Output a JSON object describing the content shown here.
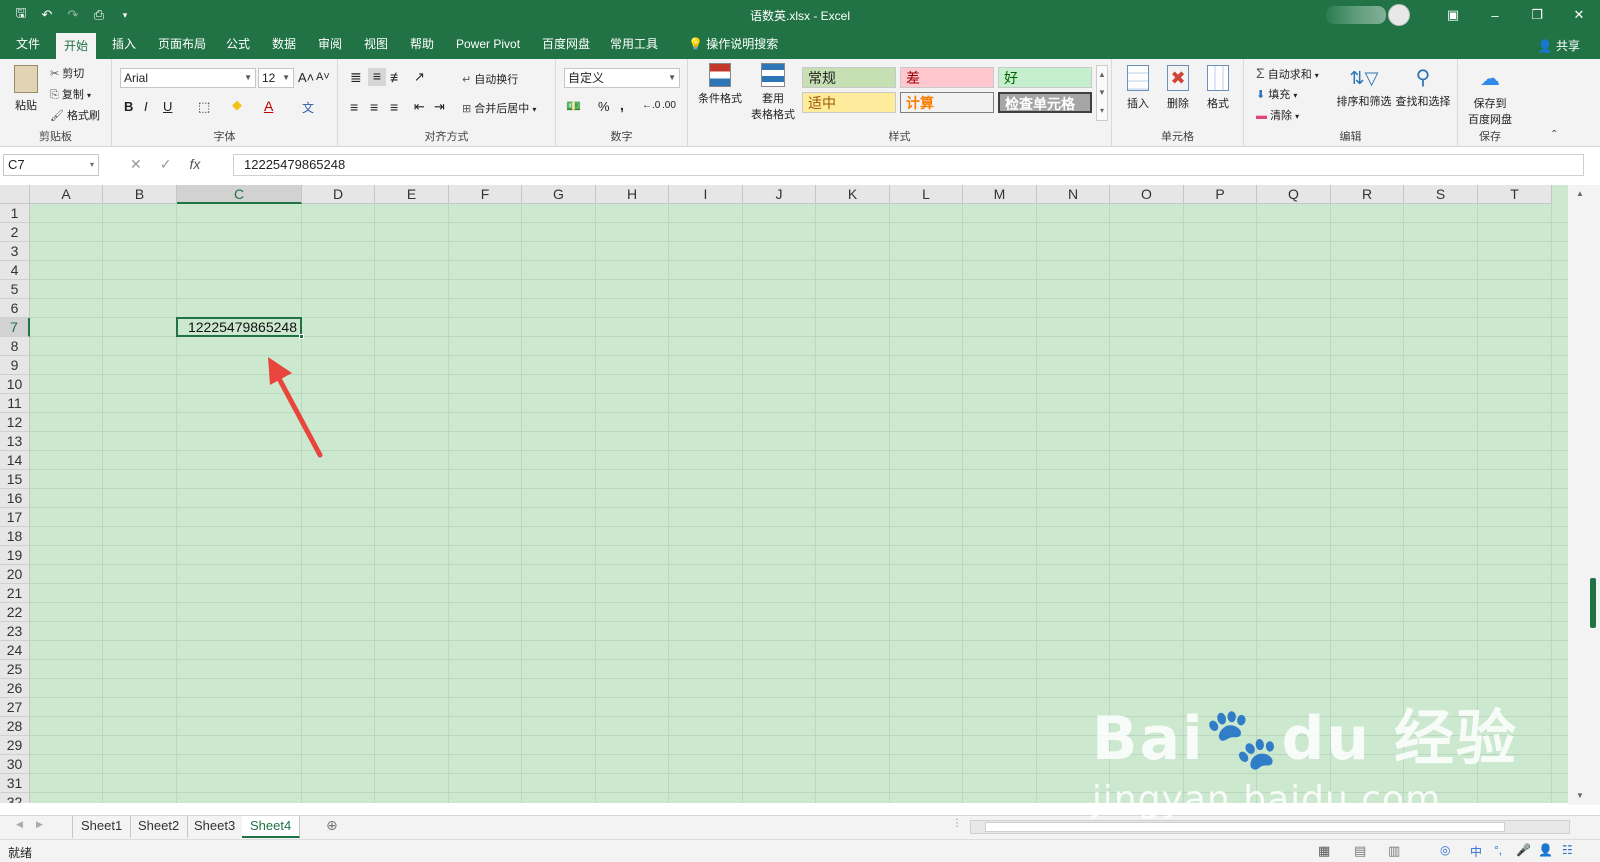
{
  "window": {
    "title": "语数英.xlsx  -  Excel",
    "controls": [
      "ribbon-display-icon",
      "minimize-icon",
      "restore-icon",
      "close-icon"
    ]
  },
  "tabs": [
    "文件",
    "开始",
    "插入",
    "页面布局",
    "公式",
    "数据",
    "审阅",
    "视图",
    "帮助",
    "Power Pivot",
    "百度网盘",
    "常用工具"
  ],
  "active_tab": "开始",
  "tell_me": "操作说明搜索",
  "share": "共享",
  "ribbon": {
    "clipboard": {
      "paste": "粘贴",
      "cut": "剪切",
      "copy": "复制",
      "format_painter": "格式刷",
      "label": "剪贴板"
    },
    "font": {
      "name": "Arial",
      "size": "12",
      "label": "字体",
      "bold": "B",
      "italic": "I",
      "underline": "U"
    },
    "alignment": {
      "wrap": "自动换行",
      "merge": "合并后居中",
      "label": "对齐方式"
    },
    "number": {
      "format": "自定义",
      "percent": "%",
      "comma": ",",
      "label": "数字"
    },
    "styles": {
      "cond_format": "条件格式",
      "table_format_1": "套用",
      "table_format_2": "表格格式",
      "normal": "常规",
      "bad": "差",
      "good": "好",
      "neutral": "适中",
      "calc": "计算",
      "check": "检查单元格",
      "label": "样式"
    },
    "cells": {
      "insert": "插入",
      "delete": "删除",
      "format": "格式",
      "label": "单元格"
    },
    "editing": {
      "autosum": "自动求和",
      "fill": "填充",
      "clear": "清除",
      "sort": "排序和筛选",
      "find": "查找和选择",
      "label": "编辑"
    },
    "save": {
      "line1": "保存到",
      "line2": "百度网盘",
      "label": "保存"
    }
  },
  "formula_bar": {
    "name_box": "C7",
    "value": "12225479865248"
  },
  "columns": [
    "A",
    "B",
    "C",
    "D",
    "E",
    "F",
    "G",
    "H",
    "I",
    "J",
    "K",
    "L",
    "M",
    "N",
    "O",
    "P",
    "Q",
    "R",
    "S",
    "T"
  ],
  "rows": [
    "1",
    "2",
    "3",
    "4",
    "5",
    "6",
    "7",
    "8",
    "9",
    "10",
    "11",
    "12",
    "13",
    "14",
    "15",
    "16",
    "17",
    "18",
    "19",
    "20",
    "21",
    "22",
    "23",
    "24",
    "25",
    "26",
    "27",
    "28",
    "29",
    "30",
    "31",
    "32"
  ],
  "selected_cell": {
    "ref": "C7",
    "value": "12225479865248"
  },
  "sheets": [
    "Sheet1",
    "Sheet2",
    "Sheet3",
    "Sheet4"
  ],
  "active_sheet": "Sheet4",
  "status": "就绪",
  "watermark": {
    "brand": "Bai",
    "brand_cn": "经验",
    "url": "jingyan.baidu.com"
  },
  "colors": {
    "excel_green": "#217346",
    "grid_bg": "#cce8cf",
    "arrow": "#e8453c"
  }
}
